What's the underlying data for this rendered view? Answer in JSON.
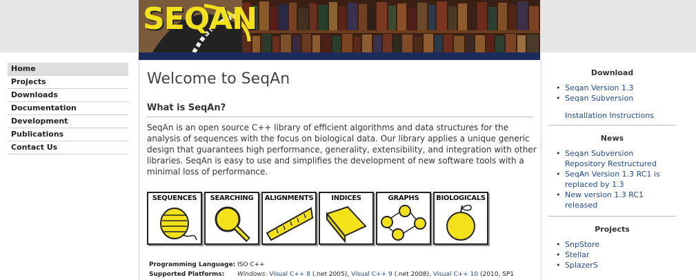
{
  "header": {
    "logo_text": "SEQAN"
  },
  "leftnav": {
    "items": [
      {
        "label": "Home",
        "active": true
      },
      {
        "label": "Projects"
      },
      {
        "label": "Downloads"
      },
      {
        "label": "Documentation"
      },
      {
        "label": "Development"
      },
      {
        "label": "Publications"
      },
      {
        "label": "Contact Us"
      }
    ]
  },
  "main": {
    "title": "Welcome to SeqAn",
    "subtitle": "What is SeqAn?",
    "intro": "SeqAn is an open source C++ library of efficient algorithms and data structures for the analysis of sequences with the focus on biological data. Our library applies a unique generic design that guarantees high performance, generality, extensibility, and integration with other libraries. SeqAn is easy to use and simplifies the development of new software tools with a minimal loss of performance.",
    "tiles": [
      "SEQUENCES",
      "SEARCHING",
      "ALIGNMENTS",
      "INDICES",
      "GRAPHS",
      "BIOLOGICALS"
    ],
    "meta": {
      "lang_label": "Programming Language:",
      "lang_value": "ISO C++",
      "platforms_label": "Supported Platforms:",
      "platforms_os": "Windows:",
      "vc8": "Visual C++ 8",
      "vc8_note": "(.net 2005),",
      "vc9": "Visual C++ 9",
      "vc9_note": "(.net 2008),",
      "vc10": "Visual C++ 10",
      "vc10_note": "(2010, SP1"
    }
  },
  "sidebar": {
    "download": {
      "heading": "Download",
      "items": [
        "Seqan Version 1.3",
        "Seqan Subversion"
      ],
      "install": "Installation Instructions"
    },
    "news": {
      "heading": "News",
      "items": [
        {
          "line1": "Seqan Subversion",
          "line2": "Repository Restructured"
        },
        {
          "line1": "SeqAn Version 1.3 RC1 is",
          "line2": "replaced by 1.3"
        },
        {
          "line1": "New version 1.3 RC1",
          "line2": "released"
        }
      ]
    },
    "projects": {
      "heading": "Projects",
      "items": [
        "SnpStore",
        "Stellar",
        "SplazerS"
      ]
    }
  },
  "colors": {
    "accent_yellow": "#f3e21a",
    "link": "#1f4b93",
    "banner_strip": "#1d2b5c"
  }
}
